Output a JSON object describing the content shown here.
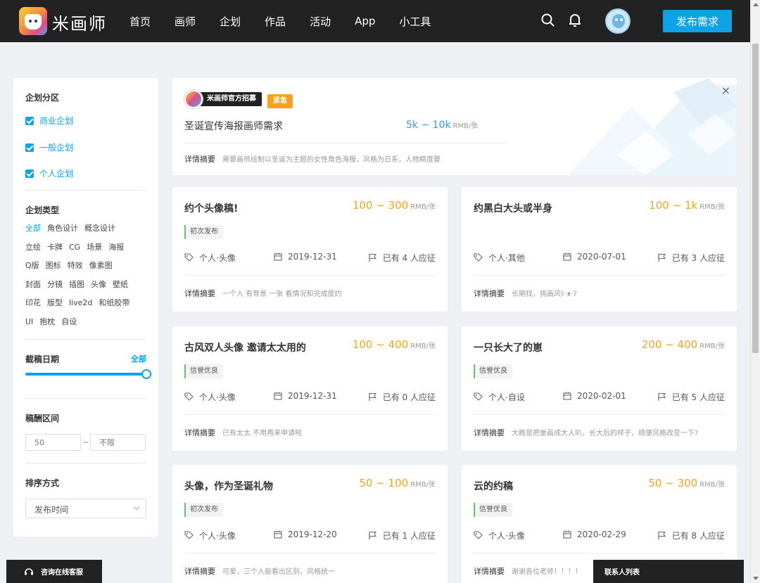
{
  "header": {
    "logo_text": "米画师",
    "nav": [
      "首页",
      "画师",
      "企划",
      "作品",
      "活动",
      "App",
      "小工具"
    ],
    "publish_label": "发布需求"
  },
  "sidebar": {
    "category_title": "企划分区",
    "categories": [
      "商业企划",
      "一般企划",
      "个人企划"
    ],
    "type_title": "企划类型",
    "types": [
      [
        "全部",
        "角色设计",
        "概念设计"
      ],
      [
        "立绘",
        "卡牌",
        "CG",
        "场景",
        "海报"
      ],
      [
        "Q版",
        "图标",
        "特效",
        "像素图"
      ],
      [
        "封面",
        "分镜",
        "插图",
        "头像",
        "壁纸"
      ],
      [
        "印花",
        "版型",
        "live2d",
        "和纸胶带"
      ],
      [
        "UI",
        "抱枕",
        "自设"
      ]
    ],
    "deadline_title": "截稿日期",
    "deadline_value": "全部",
    "deadline_fraction": 1.0,
    "fee_title": "稿酬区间",
    "fee_min_placeholder": "50",
    "fee_sep": "~",
    "fee_max_placeholder": "不限",
    "sort_title": "排序方式",
    "sort_value": "发布时间"
  },
  "featured": {
    "official_label": "米画师官方招募",
    "urgent_label": "紧急",
    "title": "圣诞宣传海报画师需求",
    "price": "5k ~ 10k",
    "unit": "RMB/张",
    "summary_label": "详情摘要",
    "summary": "需要画师绘制以圣诞为主题的女性角色海报，风格为日系，人物精度要",
    "close": "×"
  },
  "cards": [
    {
      "title": "约个头像稿!",
      "price": "100 ~ 300",
      "unit": "RMB/张",
      "tag": "初次发布",
      "category": "个人·头像",
      "date": "2019-12-31",
      "applicants": "已有 4 人应征",
      "summary_label": "详情摘要",
      "summary": "一个人 有背景 一张 看情况和完成度约"
    },
    {
      "title": "约黑白大头或半身",
      "price": "100 ~ 1k",
      "unit": "RMB/张",
      "tag": "",
      "category": "个人·其他",
      "date": "2020-07-01",
      "applicants": "已有 3 人应征",
      "summary_label": "详情摘要",
      "summary": "长期找，挑画风ʕ·ᴥ·ʔ"
    },
    {
      "title": "古风双人头像 邀请太太用的",
      "price": "100 ~ 400",
      "unit": "RMB/张",
      "tag": "信誉优良",
      "category": "个人·头像",
      "date": "2019-12-31",
      "applicants": "已有 0 人应征",
      "summary_label": "详情摘要",
      "summary": "已有太太 不用再来申请啦"
    },
    {
      "title": "一只长大了的崽",
      "price": "200 ~ 400",
      "unit": "RMB/张",
      "tag": "信誉优良",
      "category": "个人·自设",
      "date": "2020-02-01",
      "applicants": "已有 5 人应征",
      "summary_label": "详情摘要",
      "summary": "大概是把崽画成大人叭，长大后的样子，顺便风格改变一下?"
    },
    {
      "title": "头像，作为圣诞礼物",
      "price": "50 ~ 100",
      "unit": "RMB/张",
      "tag": "初次发布",
      "category": "个人·头像",
      "date": "2019-12-20",
      "applicants": "已有 1 人应征",
      "summary_label": "详情摘要",
      "summary": "可爱，三个人能看出区别，风格统一"
    },
    {
      "title": "云的约稿",
      "price": "50 ~ 300",
      "unit": "RMB/张",
      "tag": "信誉优良",
      "category": "个人·头像",
      "date": "2020-02-29",
      "applicants": "已有 8 人应征",
      "summary_label": "详情摘要",
      "summary": "谢谢各位老师！！！！"
    }
  ],
  "bottom": {
    "consult_label": "咨询在线客服",
    "contacts_label": "联系人列表"
  },
  "colors": {
    "accent": "#0da3e6",
    "price_orange": "#f7a21b",
    "topbar": "#222222"
  }
}
